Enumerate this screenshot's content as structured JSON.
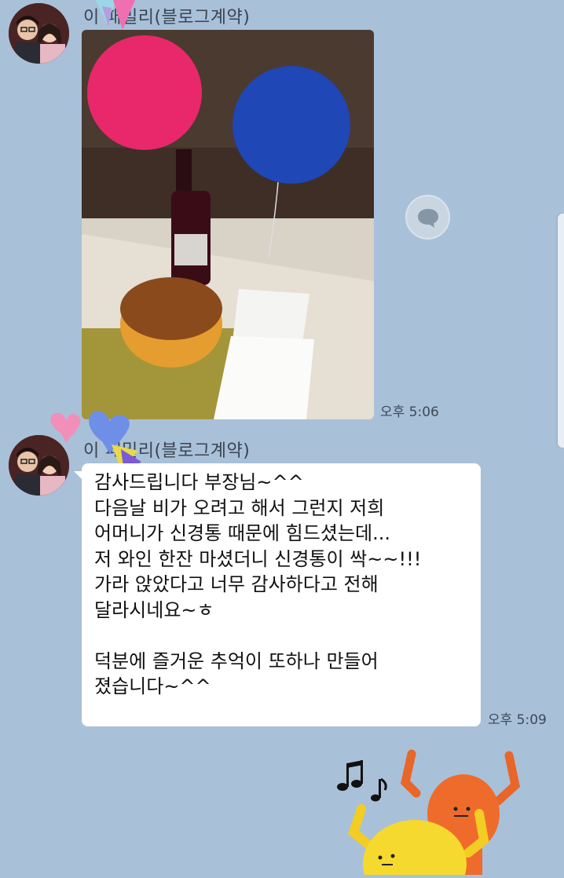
{
  "messages": [
    {
      "sender": "이 패밀리(블로그계약)",
      "type": "photo",
      "time": "오후 5:06"
    },
    {
      "sender": "이 패밀리(블로그계약)",
      "type": "text",
      "lines": [
        "감사드립니다 부장님~^^",
        "다음날 비가 오려고 해서 그런지 저희",
        "어머니가 신경통 때문에 힘드셨는데...",
        "저 와인 한잔 마셨더니 신경통이 싹~~!!!",
        "가라 앉았다고 너무 감사하다고 전해",
        "달라시네요~ㅎ",
        "",
        "덕분에 즐거운 추억이 또하나 만들어",
        "졌습니다~^^"
      ],
      "time": "오후 5:09"
    },
    {
      "type": "sticker",
      "sticker_name": "dancing-characters-sticker"
    }
  ],
  "icons": {
    "share": "share-speech-bubble-icon"
  },
  "colors": {
    "chat_background": "#a9c0d9",
    "bubble": "#ffffff"
  }
}
